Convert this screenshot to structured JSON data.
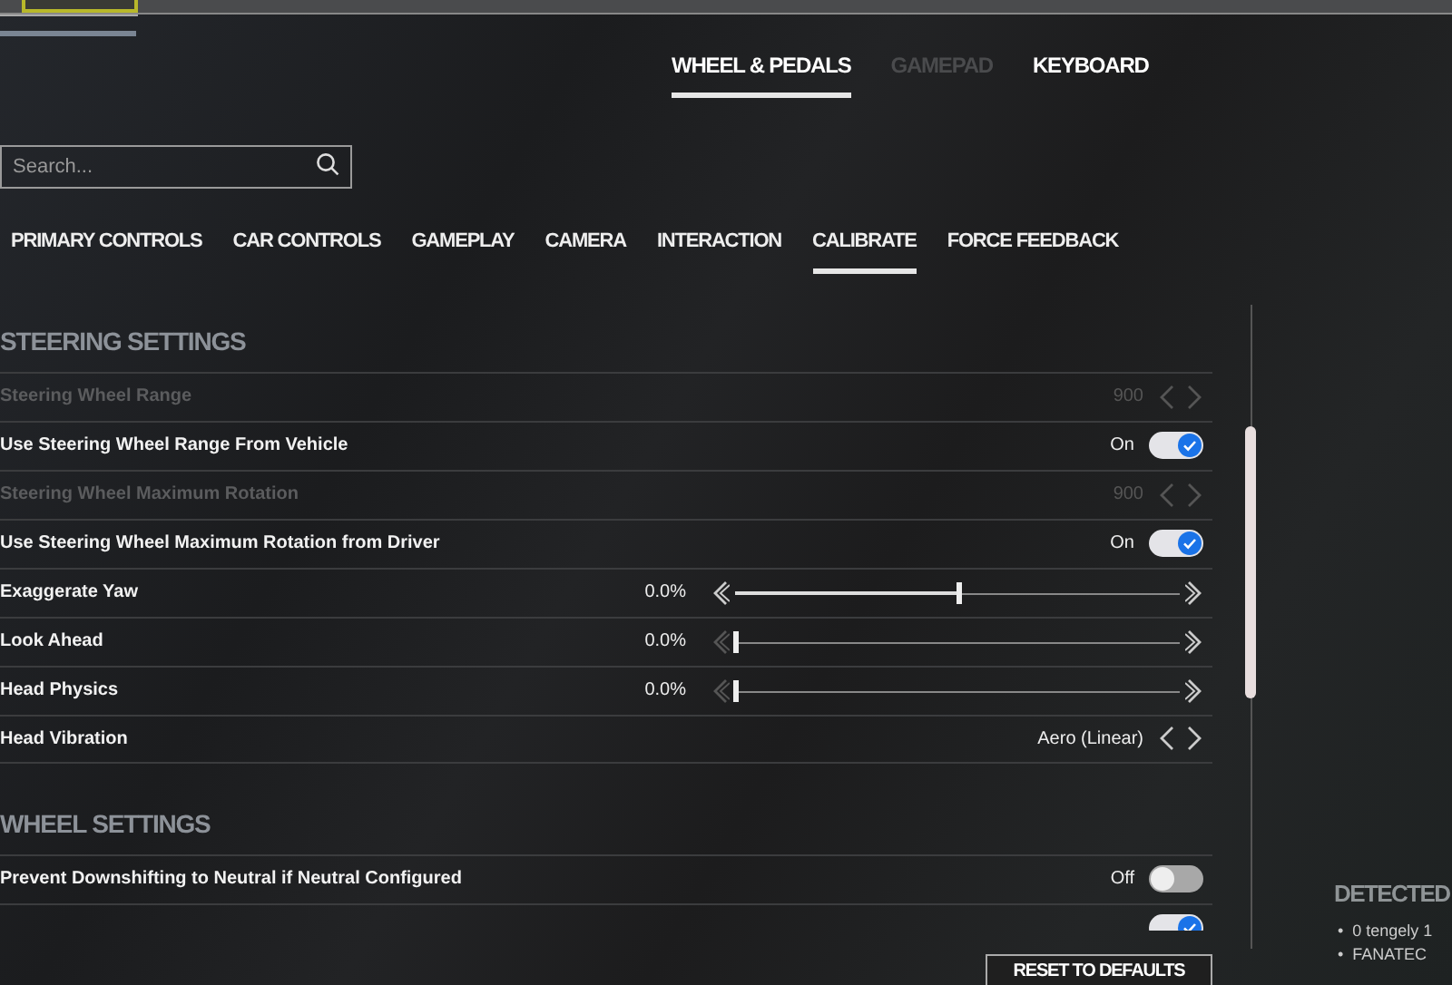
{
  "device_tabs": [
    {
      "label": "WHEEL & PEDALS",
      "selected": true,
      "disabled": false
    },
    {
      "label": "GAMEPAD",
      "selected": false,
      "disabled": true
    },
    {
      "label": "KEYBOARD",
      "selected": false,
      "disabled": false
    }
  ],
  "search": {
    "placeholder": "Search..."
  },
  "category_tabs": [
    {
      "label": "PRIMARY CONTROLS",
      "selected": false
    },
    {
      "label": "CAR CONTROLS",
      "selected": false
    },
    {
      "label": "GAMEPLAY",
      "selected": false
    },
    {
      "label": "CAMERA",
      "selected": false
    },
    {
      "label": "INTERACTION",
      "selected": false
    },
    {
      "label": "CALIBRATE",
      "selected": true
    },
    {
      "label": "FORCE FEEDBACK",
      "selected": false
    }
  ],
  "sections": [
    {
      "title": "STEERING SETTINGS",
      "rows": [
        {
          "kind": "stepper",
          "label": "Steering Wheel Range",
          "value": "900",
          "disabled": true
        },
        {
          "kind": "toggle",
          "label": "Use Steering Wheel Range From Vehicle",
          "value": "On",
          "on": true
        },
        {
          "kind": "stepper",
          "label": "Steering Wheel Maximum Rotation",
          "value": "900",
          "disabled": true
        },
        {
          "kind": "toggle",
          "label": "Use Steering Wheel Maximum Rotation from Driver",
          "value": "On",
          "on": true
        },
        {
          "kind": "slider",
          "label": "Exaggerate Yaw",
          "value": "0.0%",
          "level": 0.5
        },
        {
          "kind": "slider",
          "label": "Look Ahead",
          "value": "0.0%",
          "level": 0
        },
        {
          "kind": "slider",
          "label": "Head Physics",
          "value": "0.0%",
          "level": 0
        },
        {
          "kind": "stepper",
          "label": "Head Vibration",
          "value": "Aero (Linear)",
          "disabled": false
        }
      ]
    },
    {
      "title": "WHEEL SETTINGS",
      "rows": [
        {
          "kind": "toggle",
          "label": "Prevent Downshifting to Neutral if Neutral Configured",
          "value": "Off",
          "on": false
        },
        {
          "kind": "toggle",
          "on": true
        }
      ]
    }
  ],
  "reset_button": "RESET TO DEFAULTS",
  "detected_panel": {
    "title": "DETECTED",
    "items": [
      {
        "marker": "•",
        "text": "0 tengely 1"
      },
      {
        "marker": "•",
        "text": "FANATEC"
      }
    ]
  }
}
